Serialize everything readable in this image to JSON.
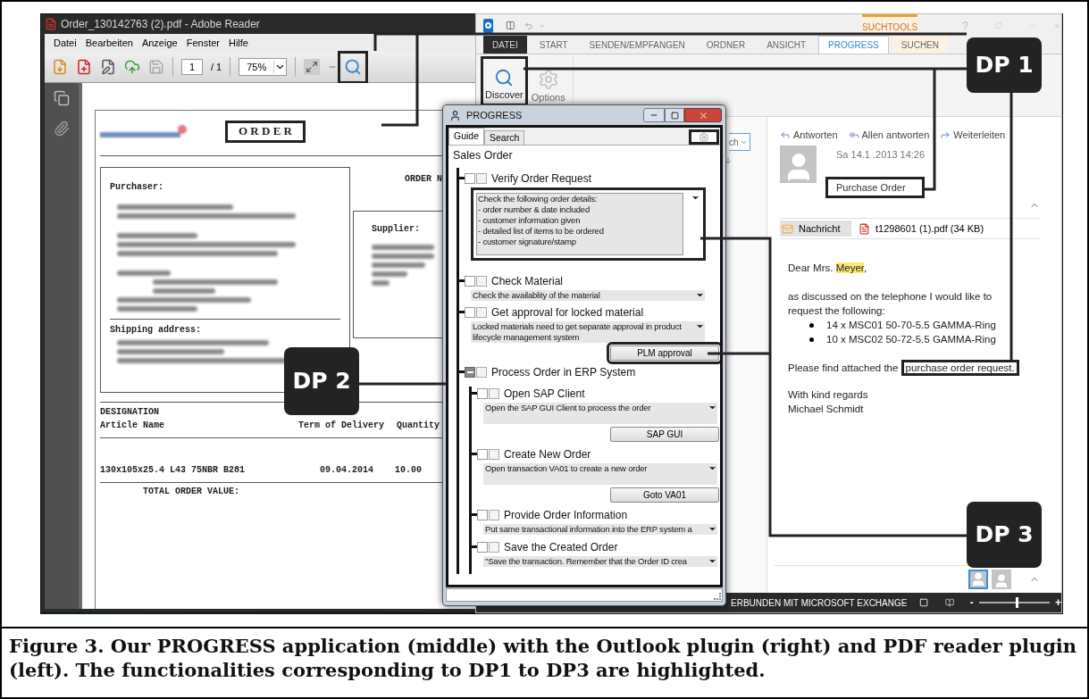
{
  "pdf_reader": {
    "title": "Order_130142763 (2).pdf - Adobe Reader",
    "menu": [
      "Datei",
      "Bearbeiten",
      "Anzeige",
      "Fenster",
      "Hilfe"
    ],
    "page_number": "1",
    "page_total": "/ 1",
    "zoom": "75%",
    "search_button": {
      "highlighted": true
    },
    "document": {
      "heading": {
        "text": "O R D E R",
        "highlighted": true
      },
      "order_number_label": "ORDER N",
      "purchaser_label": "Purchaser:",
      "supplier_label": "Supplier:",
      "shipping_label": "Shipping address:",
      "columns": [
        {
          "lines": [
            "DESIGNATION",
            "Article Name"
          ]
        },
        {
          "lines": [
            "Term of Delivery"
          ]
        },
        {
          "lines": [
            "Quantity"
          ]
        }
      ],
      "rows": [
        [
          "130x105x25.4 L43 75NBR B281",
          "09.04.2014",
          "10.00"
        ]
      ],
      "total_label": "TOTAL ORDER VALUE:"
    }
  },
  "outlook": {
    "contextual_tab": "SUCHTOOLS",
    "help": "?",
    "tabs": [
      {
        "label": "DATEI",
        "kind": "file",
        "selected": false
      },
      {
        "label": "START",
        "kind": "normal",
        "selected": false
      },
      {
        "label": "SENDEN/EMPFANGEN",
        "kind": "normal",
        "selected": false
      },
      {
        "label": "ORDNER",
        "kind": "normal",
        "selected": false
      },
      {
        "label": "ANSICHT",
        "kind": "normal",
        "selected": false
      },
      {
        "label": "PROGRESS",
        "kind": "normal",
        "selected": true
      },
      {
        "label": "SUCHEN",
        "kind": "contextual",
        "selected": false
      }
    ],
    "ribbon_buttons": [
      {
        "label": "Discover",
        "kind": "discover",
        "disabled": false,
        "highlighted": true
      },
      {
        "label": "Options",
        "kind": "options",
        "disabled": true,
        "highlighted": false
      }
    ],
    "search_box": "ch",
    "reading_pane": {
      "actions": [
        "Antworten",
        "Allen antworten",
        "Weiterleiten"
      ],
      "date": "Sa 14.1 .2013 14:26",
      "subject": {
        "text": "Purchase Order",
        "highlighted": true
      },
      "attachments": [
        {
          "label": "Nachricht",
          "kind": "message",
          "selected": true
        },
        {
          "label": "t1298601 (1).pdf (34 KB)",
          "kind": "pdf",
          "selected": false
        }
      ],
      "body": {
        "greeting": "Dear Mrs. ",
        "greeting_highlight": "Meyer",
        "greeting_end": ",",
        "intro": "as discussed on the telephone I would like to request the following:",
        "items": [
          "14 x MSC01 50-70-5.5 GAMMA-Ring",
          "10 x MSC02 50-72-5.5 GAMMA-Ring"
        ],
        "closing_lead": "Please find attached the ",
        "closing_link": {
          "text": "purchase order request.",
          "highlighted": true
        },
        "regards": "With kind regards",
        "signature": "Michael Schmidt"
      }
    },
    "status_bar": {
      "text": "ERBUNDEN MIT MICROSOFT EXCHANGE",
      "zoom_out": "-",
      "zoom_in": "+",
      "zoom_slider": {
        "level": 0.52
      }
    }
  },
  "progress": {
    "title": "PROGRESS",
    "settings_highlighted": true,
    "panel_highlighted": true,
    "tabs": [
      {
        "label": "Guide",
        "selected": true
      },
      {
        "label": "Search",
        "selected": false
      }
    ],
    "process": "Sales Order",
    "steps": [
      {
        "kind": "task",
        "title": "Verify Order Request",
        "checked": false,
        "description": {
          "text": "Check the following order details:\n- order number & date included\n- customer information given\n- detailed list of items to be ordered\n- customer signature/stamp",
          "highlighted": true
        }
      },
      {
        "kind": "task",
        "title": "Check Material",
        "checked": false,
        "description": {
          "text": "Check the availablity of the material",
          "highlighted": false
        }
      },
      {
        "kind": "task",
        "title": "Get approval for locked material",
        "checked": false,
        "description": {
          "text": "Locked materials need to get separate approval in product\nlifecycle management system",
          "highlighted": false
        },
        "button": {
          "label": "PLM approval",
          "highlighted": true
        }
      },
      {
        "kind": "group",
        "title": "Process Order in ERP System",
        "checked": false,
        "expanded": true,
        "children": [
          {
            "kind": "task",
            "title": "Open SAP Client",
            "checked": false,
            "description": {
              "text": "Open the SAP GUI Client to process the order",
              "highlighted": false
            },
            "button": {
              "label": "SAP GUI",
              "highlighted": false
            }
          },
          {
            "kind": "task",
            "title": "Create New Order",
            "checked": false,
            "description": {
              "text": "Open transaction VA01 to create a new order",
              "highlighted": false
            },
            "button": {
              "label": "Goto VA01",
              "highlighted": false
            }
          },
          {
            "kind": "task",
            "title": "Provide Order Information",
            "checked": false,
            "description": {
              "text": "Put same transactional information into the ERP system a",
              "highlighted": false
            }
          },
          {
            "kind": "task",
            "title": "Save the Created Order",
            "checked": false,
            "description": {
              "text": "\"Save the transaction. Remember that the Order ID crea",
              "highlighted": false
            }
          }
        ]
      }
    ]
  },
  "callouts": [
    {
      "label": "DP 1"
    },
    {
      "label": "DP 2"
    },
    {
      "label": "DP 3"
    }
  ],
  "caption": "Figure 3. Our PROGRESS application (middle) with the Outlook plugin (right) and PDF reader plugin (left). The functionalities corresponding to DP1 to DP3 are highlighted."
}
